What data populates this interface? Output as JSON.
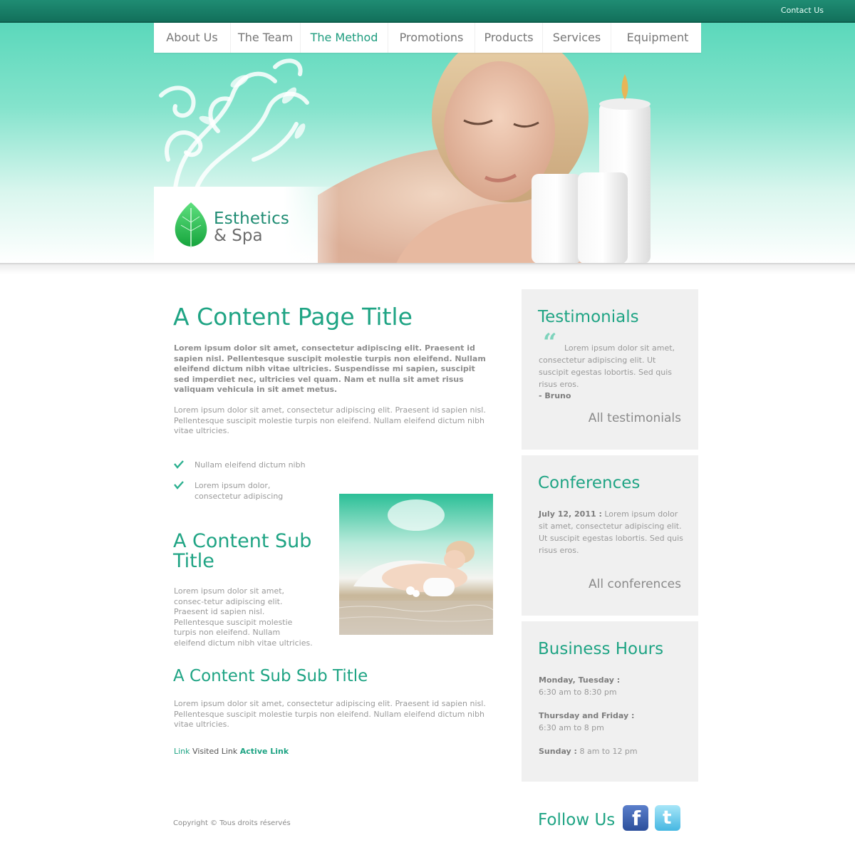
{
  "header": {
    "contact_label": "Contact Us"
  },
  "nav": {
    "items": [
      {
        "label": "About Us"
      },
      {
        "label": "The Team"
      },
      {
        "label": "The Method"
      },
      {
        "label": "Promotions"
      },
      {
        "label": "Products"
      },
      {
        "label": "Services"
      },
      {
        "label": "Equipment"
      }
    ],
    "active_index": 2
  },
  "brand": {
    "line1": "Esthetics",
    "line2": "& Spa"
  },
  "content": {
    "title": "A Content Page Title",
    "lead": "Lorem ipsum dolor sit amet, consectetur adipiscing elit. Praesent id sapien nisl. Pellentesque suscipit molestie turpis non eleifend. Nullam eleifend dictum nibh vitae ultricies. Suspendisse mi sapien, suscipit sed imperdiet nec, ultricies vel quam. Nam et nulla sit amet risus valiquam vehicula in sit amet metus.",
    "paragraph1": "Lorem ipsum dolor sit amet, consectetur adipiscing elit. Praesent id sapien nisl. Pellentesque suscipit molestie turpis non eleifend. Nullam eleifend dictum nibh vitae ultricies.",
    "bullets": [
      "Nullam eleifend dictum nibh",
      "Lorem ipsum dolor, consectetur adipiscing"
    ],
    "subtitle": "A Content Sub Title",
    "sub_paragraph": "Lorem ipsum dolor sit amet, consec-tetur adipiscing elit. Praesent id sapien nisl. Pellentesque suscipit molestie turpis non eleifend. Nullam eleifend dictum nibh vitae ultricies.",
    "subsubtitle": "A Content Sub Sub Title",
    "paragraph2": "Lorem ipsum dolor sit amet, consectetur adipiscing elit. Praesent id sapien nisl. Pellentesque suscipit molestie turpis non eleifend. Nullam eleifend dictum nibh vitae ultricies.",
    "links": {
      "link": "Link",
      "visited": "Visited Link",
      "active": "Active Link"
    }
  },
  "sidebar": {
    "testimonials": {
      "title": "Testimonials",
      "text": "Lorem ipsum dolor sit amet, consectetur adipiscing elit. Ut suscipit egestas lobortis. Sed quis risus eros.",
      "author": "- Bruno",
      "more": "All testimonials"
    },
    "conferences": {
      "title": "Conferences",
      "date": "July 12, 2011 :",
      "text": "Lorem ipsum dolor sit amet, consectetur adipiscing elit. Ut suscipit egestas lobortis. Sed quis risus eros.",
      "more": "All conferences"
    },
    "hours": {
      "title": "Business Hours",
      "rows": [
        {
          "day": "Monday, Tuesday :",
          "time": "6:30 am to 8:30 pm"
        },
        {
          "day": "Thursday and Friday :",
          "time": "6:30 am to 8 pm"
        },
        {
          "day": "Sunday :",
          "time": "8 am to 12 pm"
        }
      ]
    }
  },
  "footer": {
    "copyright": "Copyright © Tous droits réservés",
    "follow": "Follow Us",
    "social": [
      {
        "icon": "facebook-icon",
        "glyph": "f"
      },
      {
        "icon": "twitter-icon",
        "glyph": "t"
      }
    ]
  },
  "colors": {
    "accent": "#1fa484",
    "topbar": "#1f8c73",
    "panel": "#f0f0f0"
  }
}
